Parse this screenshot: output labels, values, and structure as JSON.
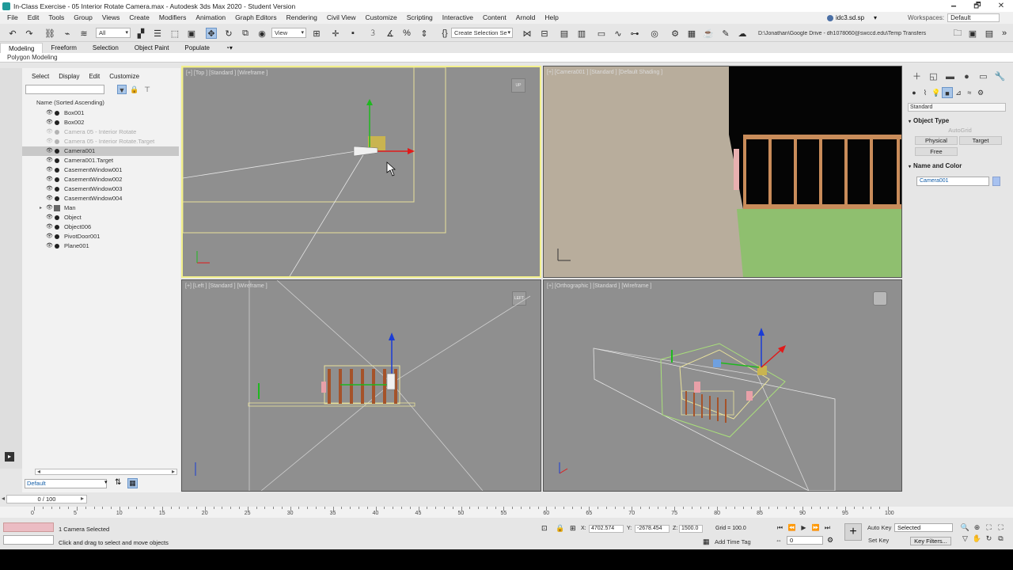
{
  "window": {
    "title": "In-Class Exercise - 05 Interior Rotate Camera.max - Autodesk 3ds Max 2020 - Student Version",
    "minimize": "🗕",
    "restore": "🗗",
    "close": "✕"
  },
  "menu": [
    "File",
    "Edit",
    "Tools",
    "Group",
    "Views",
    "Create",
    "Modifiers",
    "Animation",
    "Graph Editors",
    "Rendering",
    "Civil View",
    "Customize",
    "Scripting",
    "Interactive",
    "Content",
    "Arnold",
    "Help"
  ],
  "user": {
    "name": "idc3.sd.sp",
    "workspaces_label": "Workspaces:",
    "workspace": "Default"
  },
  "toolbar": {
    "filter": "All",
    "ref_coord": "View",
    "selection_set": "Create Selection Se",
    "path": "D:\\Jonathan\\Google Drive - dh1078060@swccd.edu\\Temp Transfers"
  },
  "ribbon": {
    "tabs": [
      "Modeling",
      "Freeform",
      "Selection",
      "Object Paint",
      "Populate"
    ],
    "active": "Modeling",
    "sub": "Polygon Modeling"
  },
  "scene_explorer": {
    "tabs": [
      "Select",
      "Display",
      "Edit",
      "Customize"
    ],
    "column_header": "Name (Sorted Ascending)",
    "objects": [
      {
        "name": "Box001",
        "state": "normal"
      },
      {
        "name": "Box002",
        "state": "normal"
      },
      {
        "name": "Camera 05 - Interior Rotate",
        "state": "frozen"
      },
      {
        "name": "Camera 05 - Interior Rotate.Target",
        "state": "frozen"
      },
      {
        "name": "Camera001",
        "state": "selected"
      },
      {
        "name": "Camera001.Target",
        "state": "normal"
      },
      {
        "name": "CasementWindow001",
        "state": "normal"
      },
      {
        "name": "CasementWindow002",
        "state": "normal"
      },
      {
        "name": "CasementWindow003",
        "state": "normal"
      },
      {
        "name": "CasementWindow004",
        "state": "normal"
      },
      {
        "name": "Man",
        "state": "group"
      },
      {
        "name": "Object",
        "state": "normal"
      },
      {
        "name": "Object006",
        "state": "normal"
      },
      {
        "name": "PivotDoor001",
        "state": "normal"
      },
      {
        "name": "Plane001",
        "state": "normal"
      }
    ],
    "layer": "Default"
  },
  "viewports": {
    "top": "[+] [Top ] [Standard ] [Wireframe ]",
    "camera": "[+] [Camera001 ] [Standard ] [Default Shading ]",
    "left": "[+] [Left ] [Standard ] [Wireframe ]",
    "ortho": "[+] [Orthographic ] [Standard ] [Wireframe ]",
    "top_cube": "UP",
    "left_cube": "LEFT"
  },
  "command_panel": {
    "category": "Standard",
    "object_type_title": "Object Type",
    "autogrid": "AutoGrid",
    "buttons": [
      "Physical",
      "Target",
      "Free"
    ],
    "name_color_title": "Name and Color",
    "name_value": "Camera001",
    "color": "#a8c2f0"
  },
  "timeline": {
    "frame_display": "0 / 100",
    "ticks": [
      "0",
      "5",
      "10",
      "15",
      "20",
      "25",
      "30",
      "35",
      "40",
      "45",
      "50",
      "55",
      "60",
      "65",
      "70",
      "75",
      "80",
      "85",
      "90",
      "95",
      "100"
    ]
  },
  "status": {
    "selection": "1 Camera Selected",
    "prompt": "Click and drag to select and move objects",
    "x_label": "X:",
    "x": "4702.574",
    "y_label": "Y:",
    "y": "-2678.454",
    "z_label": "Z:",
    "z": "1500.0",
    "grid": "Grid = 100.0",
    "add_time_tag": "Add Time Tag",
    "auto_key": "Auto Key",
    "set_key": "Set Key",
    "key_mode": "Selected",
    "key_filters": "Key Filters...",
    "frame": "0"
  }
}
